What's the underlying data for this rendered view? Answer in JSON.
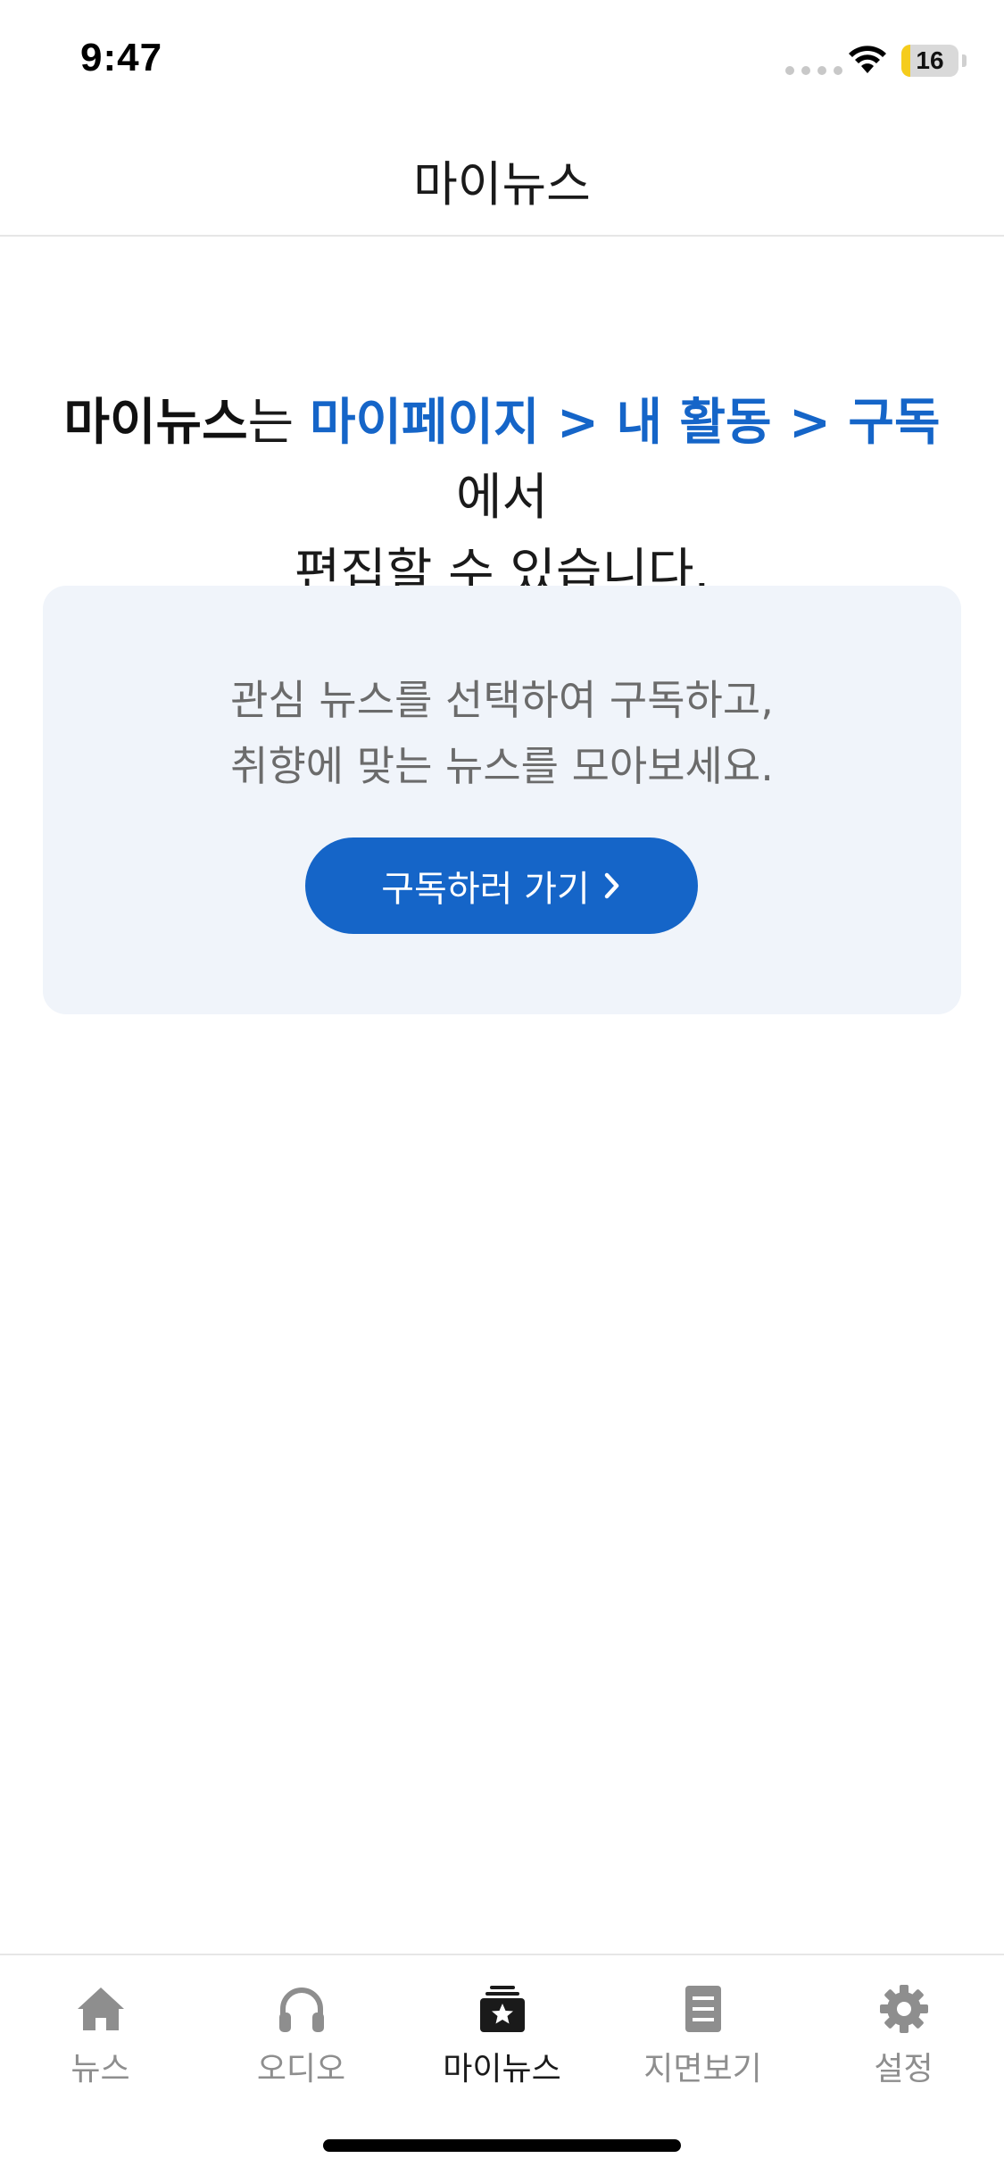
{
  "status_bar": {
    "time": "9:47",
    "battery_level": "16",
    "battery_fraction": 0.16
  },
  "header": {
    "title": "마이뉴스"
  },
  "message": {
    "part1": "마이뉴스",
    "part2": "는 ",
    "part3": "마이페이지 > 내 활동 > 구독",
    "part4": "에서",
    "line2": "편집할 수 있습니다."
  },
  "card": {
    "line1": "관심 뉴스를 선택하여 구독하고,",
    "line2": "취향에 맞는 뉴스를 모아보세요.",
    "button_label": "구독하러 가기"
  },
  "tabs": [
    {
      "label": "뉴스",
      "icon": "home-icon",
      "active": false
    },
    {
      "label": "오디오",
      "icon": "headphones-icon",
      "active": false
    },
    {
      "label": "마이뉴스",
      "icon": "star-stack-icon",
      "active": true
    },
    {
      "label": "지면보기",
      "icon": "document-icon",
      "active": false
    },
    {
      "label": "설정",
      "icon": "gear-icon",
      "active": false
    }
  ],
  "colors": {
    "accent": "#1565c8",
    "card_bg": "#f0f4fa",
    "inactive_tab": "#8e8e8e",
    "battery_yellow": "#f5cc1c"
  }
}
